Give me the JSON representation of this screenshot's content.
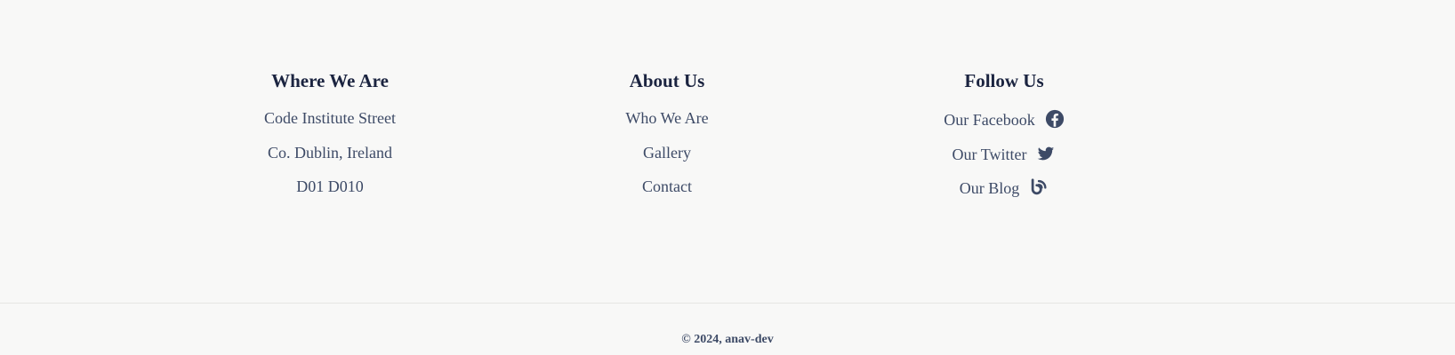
{
  "footer": {
    "columns": {
      "where": {
        "title": "Where We Are",
        "lines": [
          "Code Institute Street",
          "Co. Dublin, Ireland",
          "D01 D010"
        ]
      },
      "about": {
        "title": "About Us",
        "links": [
          "Who We Are",
          "Gallery",
          "Contact"
        ]
      },
      "follow": {
        "title": "Follow Us",
        "links": [
          {
            "label": "Our Facebook",
            "icon": "facebook-icon"
          },
          {
            "label": "Our Twitter",
            "icon": "twitter-icon"
          },
          {
            "label": "Our Blog",
            "icon": "blog-icon"
          }
        ]
      }
    },
    "copyright": "© 2024, anav-dev"
  },
  "colors": {
    "background": "#f8f8f7",
    "heading": "#1b2440",
    "text": "#3d4a66",
    "divider": "#e6e6e3"
  }
}
